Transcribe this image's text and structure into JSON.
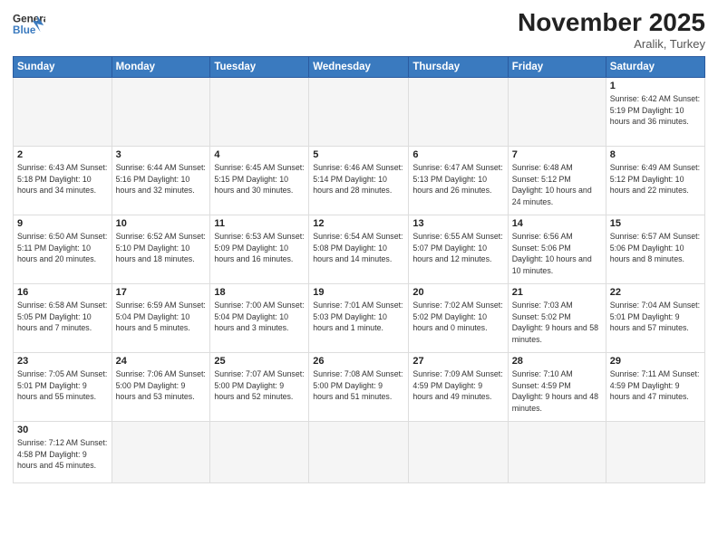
{
  "header": {
    "logo_general": "General",
    "logo_blue": "Blue",
    "month_title": "November 2025",
    "subtitle": "Aralik, Turkey"
  },
  "days_of_week": [
    "Sunday",
    "Monday",
    "Tuesday",
    "Wednesday",
    "Thursday",
    "Friday",
    "Saturday"
  ],
  "weeks": [
    [
      {
        "day": "",
        "info": ""
      },
      {
        "day": "",
        "info": ""
      },
      {
        "day": "",
        "info": ""
      },
      {
        "day": "",
        "info": ""
      },
      {
        "day": "",
        "info": ""
      },
      {
        "day": "",
        "info": ""
      },
      {
        "day": "1",
        "info": "Sunrise: 6:42 AM\nSunset: 5:19 PM\nDaylight: 10 hours\nand 36 minutes."
      }
    ],
    [
      {
        "day": "2",
        "info": "Sunrise: 6:43 AM\nSunset: 5:18 PM\nDaylight: 10 hours\nand 34 minutes."
      },
      {
        "day": "3",
        "info": "Sunrise: 6:44 AM\nSunset: 5:16 PM\nDaylight: 10 hours\nand 32 minutes."
      },
      {
        "day": "4",
        "info": "Sunrise: 6:45 AM\nSunset: 5:15 PM\nDaylight: 10 hours\nand 30 minutes."
      },
      {
        "day": "5",
        "info": "Sunrise: 6:46 AM\nSunset: 5:14 PM\nDaylight: 10 hours\nand 28 minutes."
      },
      {
        "day": "6",
        "info": "Sunrise: 6:47 AM\nSunset: 5:13 PM\nDaylight: 10 hours\nand 26 minutes."
      },
      {
        "day": "7",
        "info": "Sunrise: 6:48 AM\nSunset: 5:12 PM\nDaylight: 10 hours\nand 24 minutes."
      },
      {
        "day": "8",
        "info": "Sunrise: 6:49 AM\nSunset: 5:12 PM\nDaylight: 10 hours\nand 22 minutes."
      }
    ],
    [
      {
        "day": "9",
        "info": "Sunrise: 6:50 AM\nSunset: 5:11 PM\nDaylight: 10 hours\nand 20 minutes."
      },
      {
        "day": "10",
        "info": "Sunrise: 6:52 AM\nSunset: 5:10 PM\nDaylight: 10 hours\nand 18 minutes."
      },
      {
        "day": "11",
        "info": "Sunrise: 6:53 AM\nSunset: 5:09 PM\nDaylight: 10 hours\nand 16 minutes."
      },
      {
        "day": "12",
        "info": "Sunrise: 6:54 AM\nSunset: 5:08 PM\nDaylight: 10 hours\nand 14 minutes."
      },
      {
        "day": "13",
        "info": "Sunrise: 6:55 AM\nSunset: 5:07 PM\nDaylight: 10 hours\nand 12 minutes."
      },
      {
        "day": "14",
        "info": "Sunrise: 6:56 AM\nSunset: 5:06 PM\nDaylight: 10 hours\nand 10 minutes."
      },
      {
        "day": "15",
        "info": "Sunrise: 6:57 AM\nSunset: 5:06 PM\nDaylight: 10 hours\nand 8 minutes."
      }
    ],
    [
      {
        "day": "16",
        "info": "Sunrise: 6:58 AM\nSunset: 5:05 PM\nDaylight: 10 hours\nand 7 minutes."
      },
      {
        "day": "17",
        "info": "Sunrise: 6:59 AM\nSunset: 5:04 PM\nDaylight: 10 hours\nand 5 minutes."
      },
      {
        "day": "18",
        "info": "Sunrise: 7:00 AM\nSunset: 5:04 PM\nDaylight: 10 hours\nand 3 minutes."
      },
      {
        "day": "19",
        "info": "Sunrise: 7:01 AM\nSunset: 5:03 PM\nDaylight: 10 hours\nand 1 minute."
      },
      {
        "day": "20",
        "info": "Sunrise: 7:02 AM\nSunset: 5:02 PM\nDaylight: 10 hours\nand 0 minutes."
      },
      {
        "day": "21",
        "info": "Sunrise: 7:03 AM\nSunset: 5:02 PM\nDaylight: 9 hours\nand 58 minutes."
      },
      {
        "day": "22",
        "info": "Sunrise: 7:04 AM\nSunset: 5:01 PM\nDaylight: 9 hours\nand 57 minutes."
      }
    ],
    [
      {
        "day": "23",
        "info": "Sunrise: 7:05 AM\nSunset: 5:01 PM\nDaylight: 9 hours\nand 55 minutes."
      },
      {
        "day": "24",
        "info": "Sunrise: 7:06 AM\nSunset: 5:00 PM\nDaylight: 9 hours\nand 53 minutes."
      },
      {
        "day": "25",
        "info": "Sunrise: 7:07 AM\nSunset: 5:00 PM\nDaylight: 9 hours\nand 52 minutes."
      },
      {
        "day": "26",
        "info": "Sunrise: 7:08 AM\nSunset: 5:00 PM\nDaylight: 9 hours\nand 51 minutes."
      },
      {
        "day": "27",
        "info": "Sunrise: 7:09 AM\nSunset: 4:59 PM\nDaylight: 9 hours\nand 49 minutes."
      },
      {
        "day": "28",
        "info": "Sunrise: 7:10 AM\nSunset: 4:59 PM\nDaylight: 9 hours\nand 48 minutes."
      },
      {
        "day": "29",
        "info": "Sunrise: 7:11 AM\nSunset: 4:59 PM\nDaylight: 9 hours\nand 47 minutes."
      }
    ],
    [
      {
        "day": "30",
        "info": "Sunrise: 7:12 AM\nSunset: 4:58 PM\nDaylight: 9 hours\nand 45 minutes."
      },
      {
        "day": "",
        "info": ""
      },
      {
        "day": "",
        "info": ""
      },
      {
        "day": "",
        "info": ""
      },
      {
        "day": "",
        "info": ""
      },
      {
        "day": "",
        "info": ""
      },
      {
        "day": "",
        "info": ""
      }
    ]
  ]
}
